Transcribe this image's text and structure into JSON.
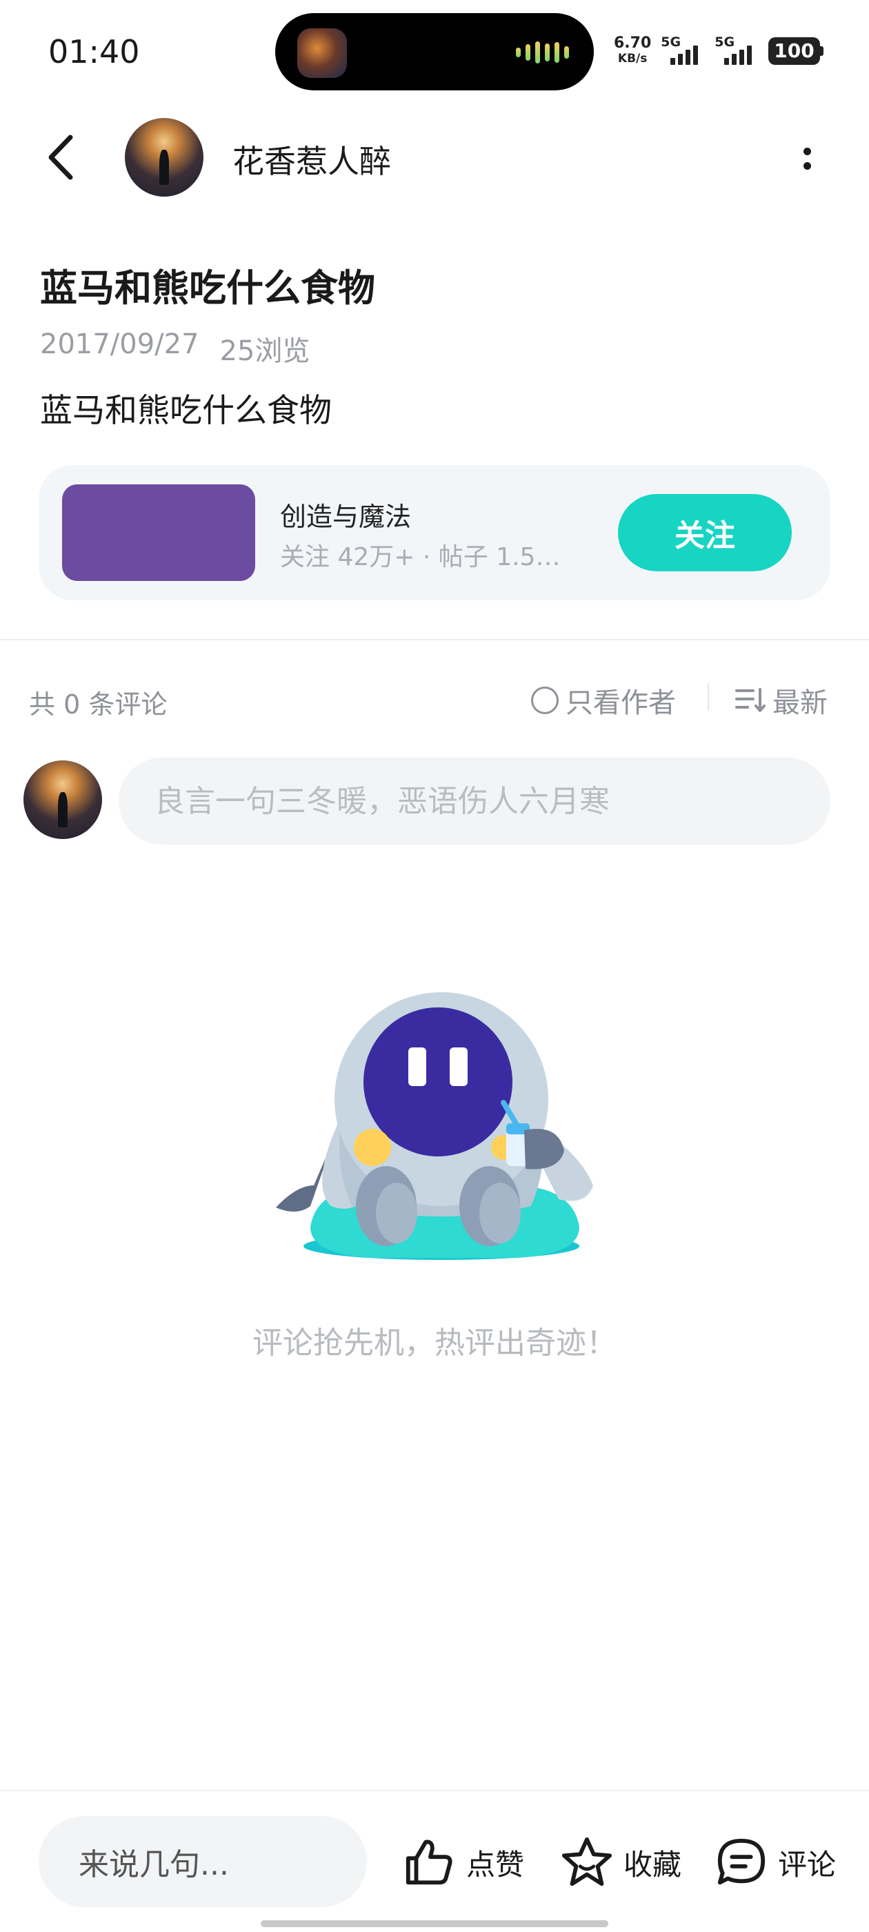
{
  "status_bar": {
    "time": "01:40",
    "net_speed_value": "6.70",
    "net_speed_unit": "KB/s",
    "sim1_label": "5G",
    "sim2_label": "5G",
    "battery": "100"
  },
  "header": {
    "back_icon": "chevron-left-icon",
    "username": "花香惹人醉",
    "more_icon": "more-vertical-icon"
  },
  "post": {
    "title": "蓝马和熊吃什么食物",
    "date": "2017/09/27",
    "views": "25浏览",
    "body": "蓝马和熊吃什么食物"
  },
  "forum_card": {
    "name": "创造与魔法",
    "stats": "关注 42万+ · 帖子 1.5…",
    "follow_label": "关注",
    "thumb_color": "#6b4ca0",
    "accent_color": "#18d4c3"
  },
  "comments": {
    "count_label": "共 0 条评论",
    "author_only_label": "只看作者",
    "sort_label": "最新",
    "input_placeholder": "良言一句三冬暖，恶语伤人六月寒",
    "empty_text": "评论抢先机，热评出奇迹！"
  },
  "bottom_bar": {
    "input_placeholder": "来说几句...",
    "like_label": "点赞",
    "favorite_label": "收藏",
    "comment_label": "评论",
    "like_icon": "thumbs-up-icon",
    "favorite_icon": "star-icon",
    "comment_icon": "comment-bubble-icon"
  }
}
